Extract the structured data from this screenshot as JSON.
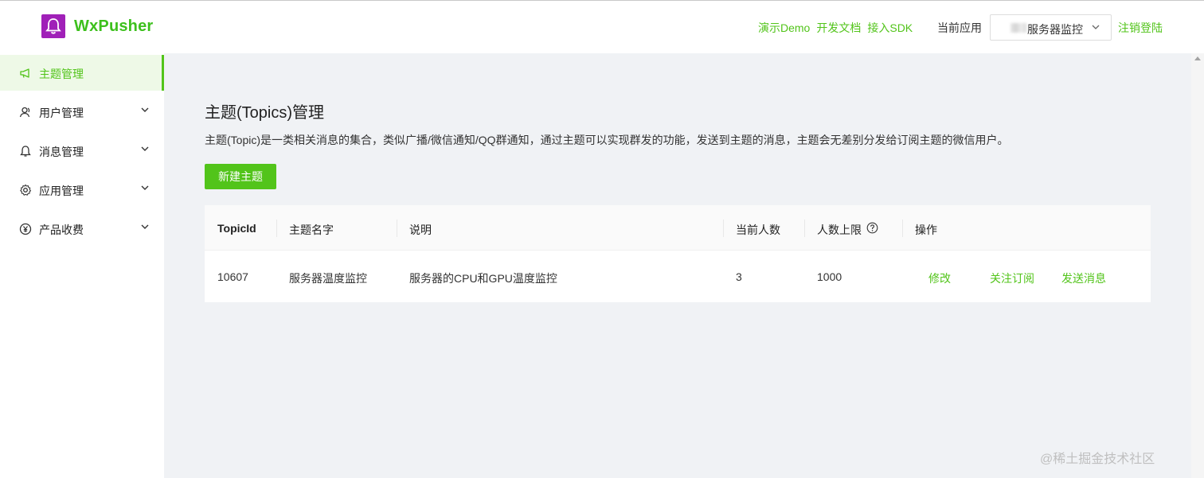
{
  "header": {
    "brand": "WxPusher",
    "nav_links": [
      "演示Demo",
      "开发文档",
      "接入SDK"
    ],
    "current_app_label": "当前应用",
    "current_app_value": "服务器监控",
    "logout": "注销登陆"
  },
  "sidebar": {
    "items": [
      {
        "label": "主题管理",
        "icon": "megaphone-icon",
        "active": true
      },
      {
        "label": "用户管理",
        "icon": "user-icon"
      },
      {
        "label": "消息管理",
        "icon": "bell-icon"
      },
      {
        "label": "应用管理",
        "icon": "gear-icon"
      },
      {
        "label": "产品收费",
        "icon": "yen-icon"
      }
    ]
  },
  "main": {
    "title": "主题(Topics)管理",
    "description": "主题(Topic)是一类相关消息的集合，类似广播/微信通知/QQ群通知，通过主题可以实现群发的功能，发送到主题的消息，主题会无差别分发给订阅主题的微信用户。",
    "new_button": "新建主题",
    "table": {
      "headers": [
        "TopicId",
        "主题名字",
        "说明",
        "当前人数",
        "人数上限",
        "操作"
      ],
      "rows": [
        {
          "topic_id": "10607",
          "name": "服务器温度监控",
          "desc": "服务器的CPU和GPU温度监控",
          "count": "3",
          "limit": "1000",
          "actions": [
            "修改",
            "关注订阅",
            "发送消息"
          ]
        }
      ]
    }
  },
  "watermark": "@稀土掘金技术社区",
  "colors": {
    "accent": "#52c41a",
    "logo": "#a020b8"
  }
}
